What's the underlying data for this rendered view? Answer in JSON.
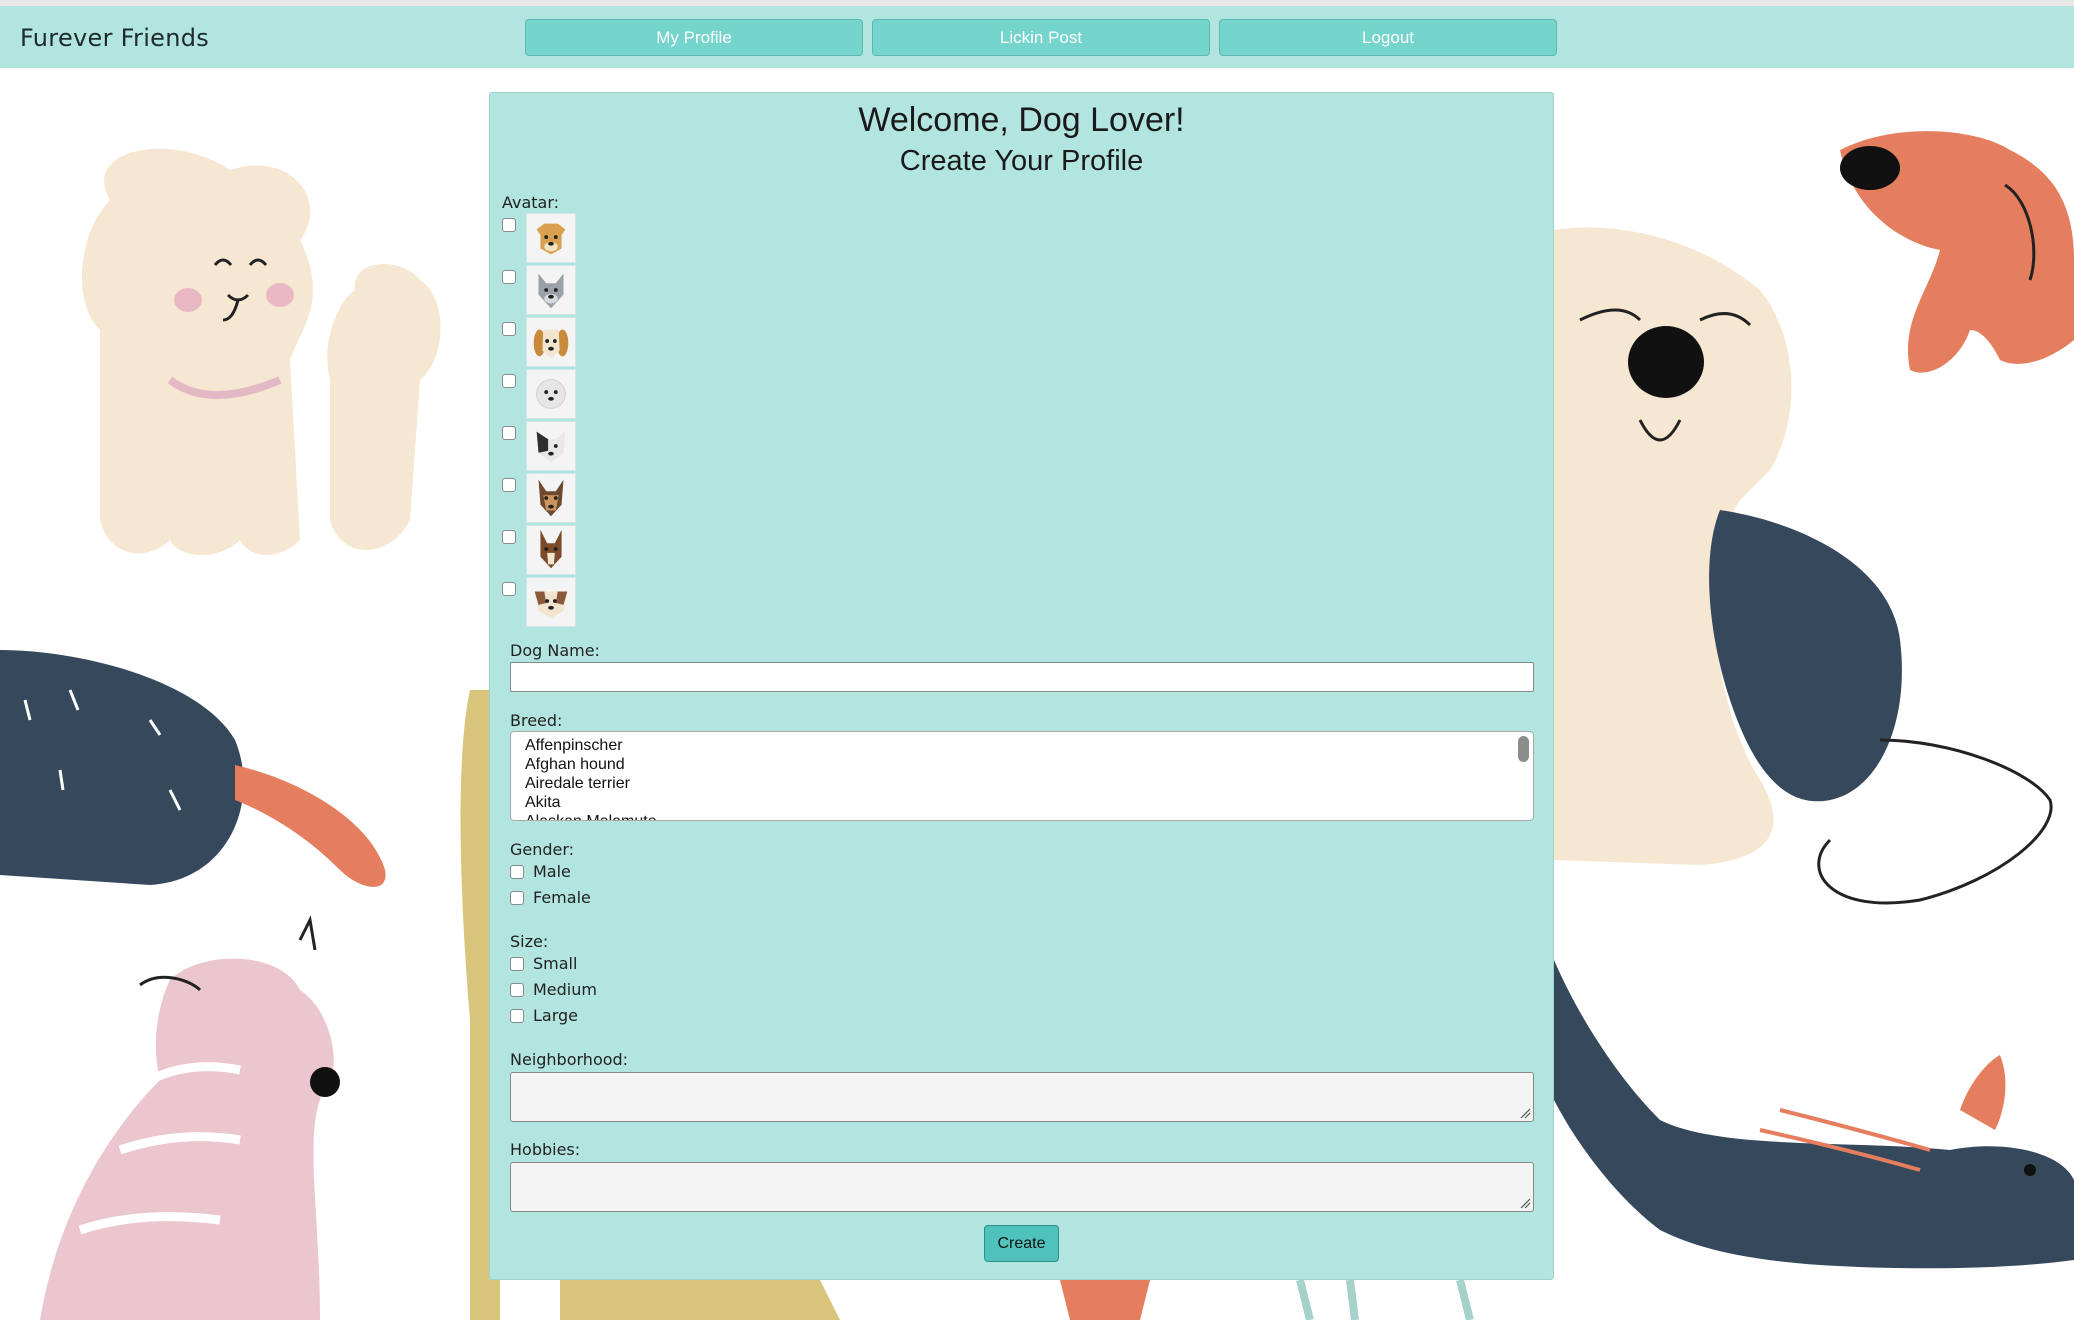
{
  "app": {
    "brand": "Furever Friends"
  },
  "nav": {
    "items": [
      {
        "label": "My Profile"
      },
      {
        "label": "Lickin Post"
      },
      {
        "label": "Logout"
      }
    ]
  },
  "form": {
    "title": "Welcome, Dog Lover!",
    "subtitle": "Create Your Profile",
    "avatar_label": "Avatar:",
    "avatars": [
      {
        "icon": "tan-dog-avatar-icon",
        "color": "#d8a04f"
      },
      {
        "icon": "gray-dog-avatar-icon",
        "color": "#9aa1a8"
      },
      {
        "icon": "spaniel-dog-avatar-icon",
        "color": "#c98a3c"
      },
      {
        "icon": "white-dog-avatar-icon",
        "color": "#e6e6e6"
      },
      {
        "icon": "black-white-dog-avatar-icon",
        "color": "#2f2f2f"
      },
      {
        "icon": "shepherd-dog-avatar-icon",
        "color": "#6b4a2e"
      },
      {
        "icon": "brown-dog-avatar-icon",
        "color": "#7a4a2b"
      },
      {
        "icon": "bulldog-avatar-icon",
        "color": "#8a5a3a"
      }
    ],
    "dog_name_label": "Dog Name:",
    "dog_name_value": "",
    "breed_label": "Breed:",
    "breeds": [
      "Affenpinscher",
      "Afghan hound",
      "Airedale terrier",
      "Akita",
      "Alaskan Malamute"
    ],
    "gender_label": "Gender:",
    "genders": [
      "Male",
      "Female"
    ],
    "size_label": "Size:",
    "sizes": [
      "Small",
      "Medium",
      "Large"
    ],
    "neighborhood_label": "Neighborhood:",
    "hobbies_label": "Hobbies:",
    "submit_label": "Create"
  },
  "colors": {
    "nav_bg": "#b3e5e0",
    "button_bg": "#75d4cc",
    "create_bg": "#4fc3bb"
  }
}
